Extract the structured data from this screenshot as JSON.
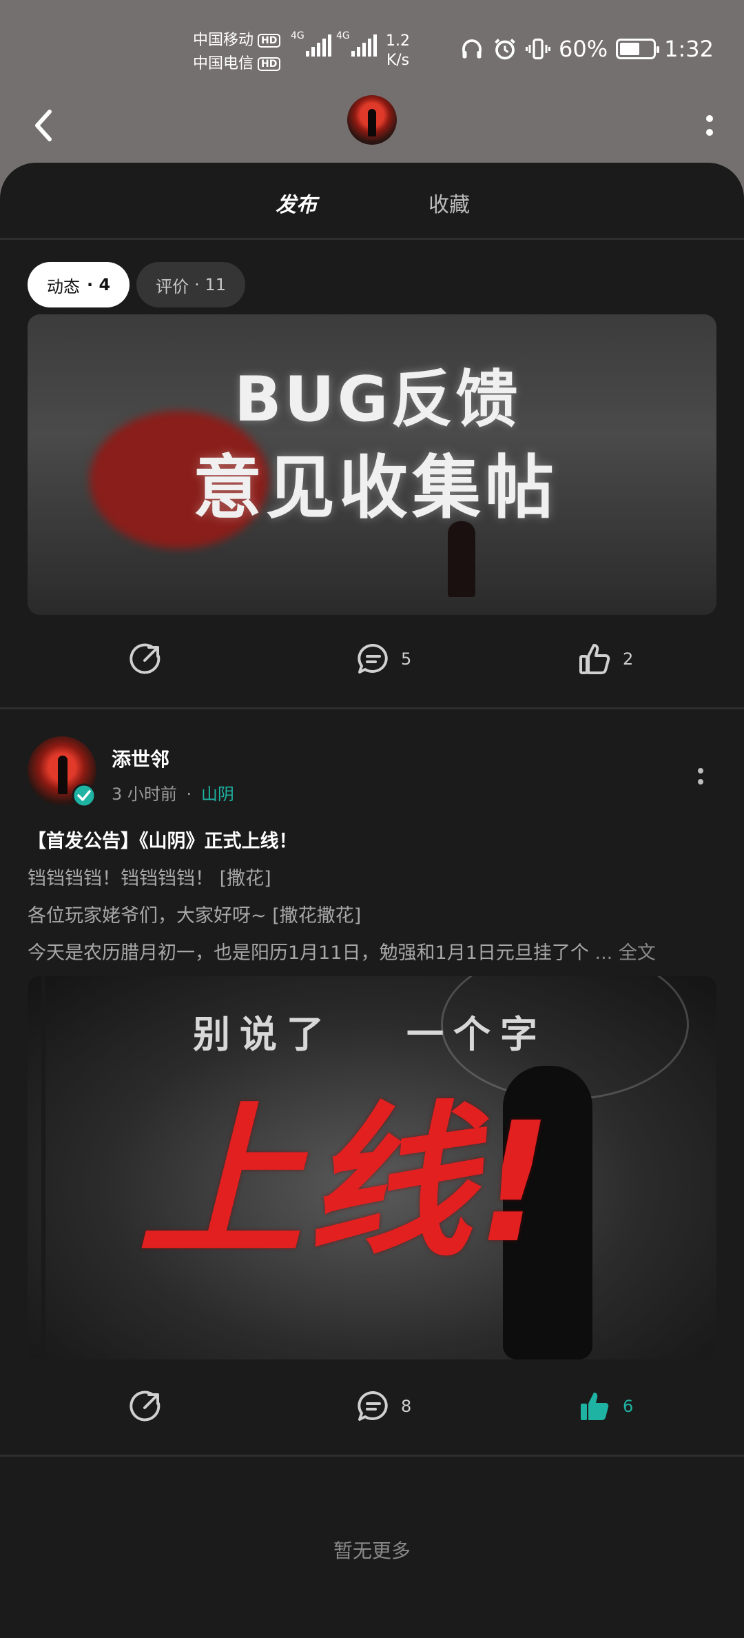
{
  "status_bar": {
    "carrier1": "中国移动",
    "carrier2": "中国电信",
    "hd": "HD",
    "net1": "4G",
    "net2": "4G",
    "speed_value": "1.2",
    "speed_unit": "K/s",
    "battery": "60%",
    "battery_level": 0.6,
    "time": "1:32"
  },
  "tabs": [
    {
      "label": "发布"
    },
    {
      "label": "收藏"
    }
  ],
  "chips": {
    "dynamic_label": "动态",
    "dynamic_count": "· 4",
    "review_label": "评价",
    "review_count": "· 11"
  },
  "banner1": {
    "line1": "BUG反馈",
    "line2": "意见收集帖"
  },
  "post1_actions": {
    "comments": "5",
    "likes": "2"
  },
  "post2": {
    "author": "添世邻",
    "time": "3 小时前",
    "separator": "·",
    "game": "山阴",
    "title": "【首发公告】《山阴》正式上线！",
    "line1": "铛铛铛铛！铛铛铛铛！ [撒花]",
    "line2": "各位玩家姥爷们，大家好呀~ [撒花撒花]",
    "line3": "今天是农历腊月初一，也是阳历1月11日，勉强和1月1日元旦挂了个",
    "more": "... 全文",
    "image_text_a": "别说了",
    "image_text_b": "一个字",
    "image_text_big": "上线!",
    "comments": "8",
    "likes": "6"
  },
  "footer": {
    "empty": "暂无更多"
  },
  "colors": {
    "accent": "#1fb3a3",
    "panel": "#1b1b1b",
    "header_bg": "#757070"
  }
}
